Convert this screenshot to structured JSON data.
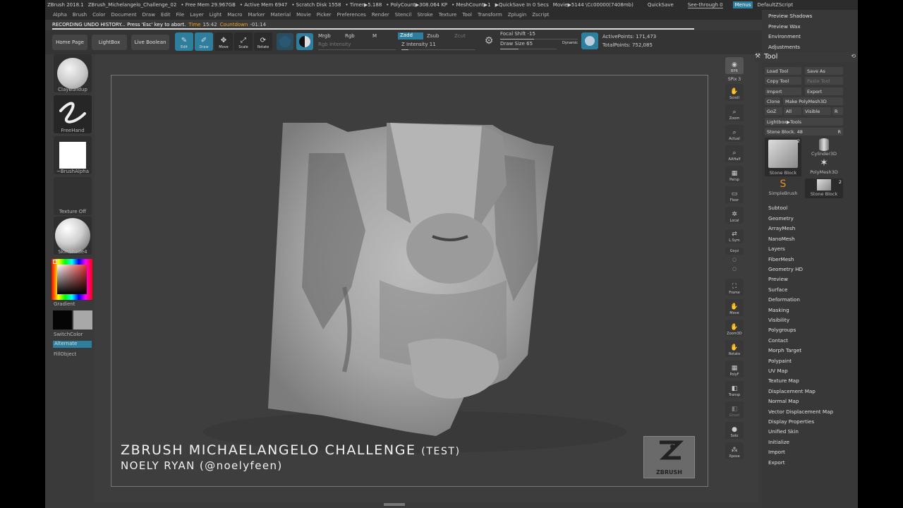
{
  "topbar": {
    "app": "ZBrush 2018.1",
    "document": "ZBrush_Michelangelo_Challenge_02",
    "free_mem": "• Free Mem 29.967GB",
    "active_mem": "• Active Mem 6947",
    "scratch": "• Scratch Disk 1558",
    "timer": "• Timer▶5.188",
    "polycount": "• PolyCount▶308.064 KP",
    "meshcount": "• MeshCount▶1",
    "quicksave_info": "▶QuickSave In 0 Secs",
    "movie": "Movie▶5144 \\Cc00000(7408mb)",
    "quicksave": "QuickSave",
    "see_through": "See-through  0",
    "menus": "Menus",
    "zscript": "DefaultZScript"
  },
  "menubar": [
    "Alpha",
    "Brush",
    "Color",
    "Document",
    "Draw",
    "Edit",
    "File",
    "Layer",
    "Light",
    "Macro",
    "Marker",
    "Material",
    "Movie",
    "Picker",
    "Preferences",
    "Render",
    "Stencil",
    "Stroke",
    "Texture",
    "Tool",
    "Transform",
    "Zplugin",
    "Zscript"
  ],
  "undo": {
    "message": "RECORDING UNDO HISTORY... Press 'Esc' key to abort.",
    "time_label": "Time",
    "time": "15:42",
    "countdown_label": "Countdown",
    "countdown": "-01:14"
  },
  "shelf": {
    "home": "Home Page",
    "lightbox": "LightBox",
    "live_boolean": "Live Boolean",
    "edit": "Edit",
    "draw": "Draw",
    "move": "Move",
    "scale": "Scale",
    "rotate": "Rotate",
    "mrgb": "Mrgb",
    "rgb": "Rgb",
    "m": "M",
    "rgb_intensity": "Rgb Intensity",
    "zadd": "Zadd",
    "zsub": "Zsub",
    "zcut": "Zcut",
    "z_intensity_label": "Z Intensity",
    "z_intensity": "11",
    "focal_label": "Focal Shift",
    "focal": "-15",
    "draw_size_label": "Draw Size",
    "draw_size": "65",
    "dynamic": "Dynamic",
    "active_points_label": "ActivePoints:",
    "active_points": "171,473",
    "total_points_label": "TotalPoints:",
    "total_points": "752,085"
  },
  "left_tray": {
    "brush": "ClayBuildup",
    "stroke": "FreeHand",
    "alpha": "~BrushAlpha",
    "texture": "Texture Off",
    "material": "SkinShade4",
    "gradient": "Gradient",
    "switch_color": "SwitchColor",
    "alternate": "Alternate",
    "fill_object": "FillObject"
  },
  "canvas": {
    "title_main": "ZBRUSH MICHAELANGELO CHALLENGE",
    "title_tag": "(TEST)",
    "author": "NOELY RYAN (@noelyfeen)",
    "logo_text": "ZBRUSH"
  },
  "right_toolbar": [
    "BPR",
    "SPix 3",
    "Scroll",
    "Zoom",
    "Actual",
    "AAHalf",
    "Persp",
    "Floor",
    "Local",
    "L.Sym",
    "Gxyz",
    "Frame",
    "Move",
    "Zoom3D",
    "Rotate",
    "PolyF",
    "Transp",
    "Ghost",
    "Solo",
    "Xpose"
  ],
  "right_panel": {
    "top_items": [
      "Preview Shadows",
      "Preview Wax",
      "Environment",
      "Adjustments"
    ],
    "tool_title": "Tool",
    "load_tool": "Load Tool",
    "save_as": "Save As",
    "copy_tool": "Copy Tool",
    "paste_tool": "Paste Tool",
    "import": "Import",
    "export": "Export",
    "clone": "Clone",
    "make_polymesh": "Make PolyMesh3D",
    "goz": "GoZ",
    "all": "All",
    "visible": "Visible",
    "r": "R",
    "lightbox_tools": "Lightbox▶Tools",
    "stone_block_label": "Stone Block.",
    "stone_block_value": "48",
    "tools": [
      "Stone Block",
      "Cylinder3D",
      "PolyMesh3D",
      "SimpleBrush",
      "Stone Block"
    ],
    "tool_badge_1": "2",
    "tool_badge_2": "2",
    "subpalettes": [
      "Subtool",
      "Geometry",
      "ArrayMesh",
      "NanoMesh",
      "Layers",
      "FiberMesh",
      "Geometry HD",
      "Preview",
      "Surface",
      "Deformation",
      "Masking",
      "Visibility",
      "Polygroups",
      "Contact",
      "Morph Target",
      "Polypaint",
      "UV Map",
      "Texture Map",
      "Displacement Map",
      "Normal Map",
      "Vector Displacement Map",
      "Display Properties",
      "Unified Skin",
      "Initialize",
      "Import",
      "Export"
    ]
  },
  "colors": {
    "accent": "#2e7e9e",
    "background": "#3a3a3a",
    "panel": "#383838",
    "countdown": "#f0a020"
  }
}
